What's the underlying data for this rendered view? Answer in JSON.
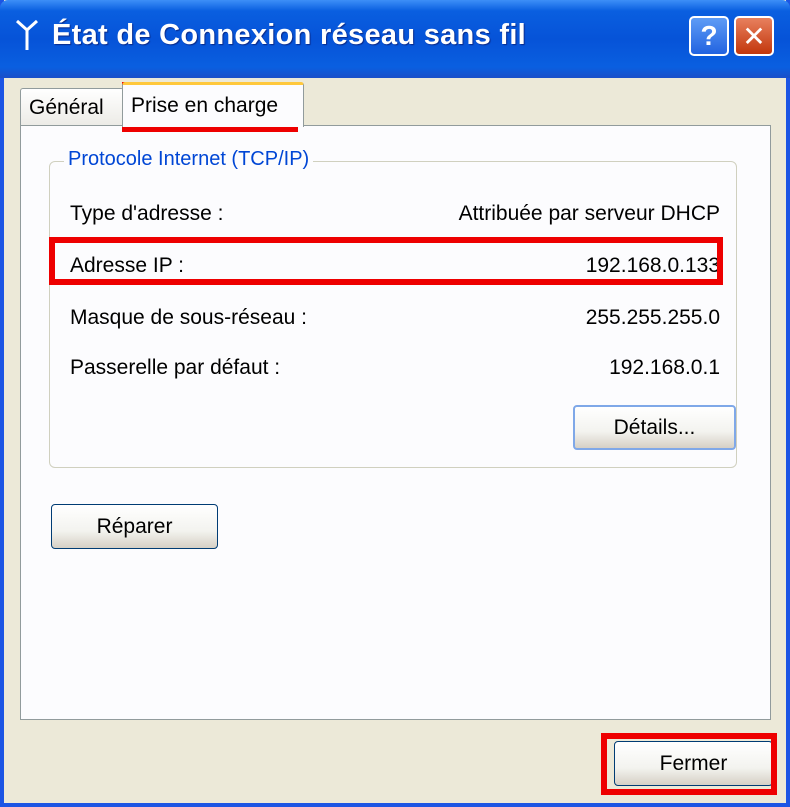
{
  "window": {
    "title": "État de Connexion réseau sans fil",
    "title_icon": "wireless-antenna-icon",
    "help_label": "?",
    "close_label": "✕"
  },
  "tabs": [
    {
      "label": "Général",
      "selected": false
    },
    {
      "label": "Prise en charge",
      "selected": true
    }
  ],
  "group": {
    "legend": "Protocole Internet (TCP/IP)",
    "rows": [
      {
        "label": "Type d'adresse :",
        "value": "Attribuée par serveur DHCP"
      },
      {
        "label": "Adresse IP :",
        "value": "192.168.0.133"
      },
      {
        "label": "Masque de sous-réseau :",
        "value": "255.255.255.0"
      },
      {
        "label": "Passerelle par défaut :",
        "value": "192.168.0.1"
      }
    ],
    "details_button": "Détails..."
  },
  "repair_button": "Réparer",
  "close_button": "Fermer",
  "colors": {
    "titlebar": "#0653d8",
    "dialog_bg": "#ece9d8",
    "highlight": "#ee0000",
    "legend_text": "#0046d5"
  }
}
